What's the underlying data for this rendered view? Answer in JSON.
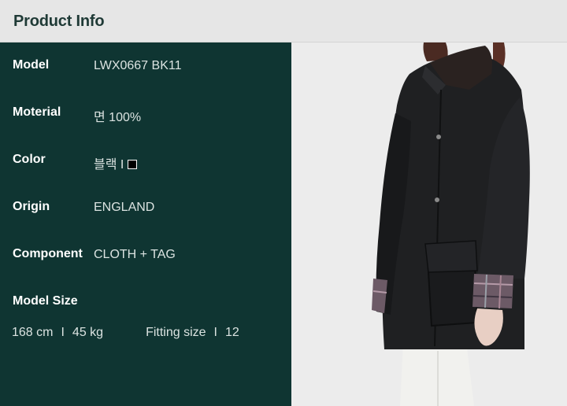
{
  "header": {
    "title": "Product Info"
  },
  "specs": [
    {
      "label": "Model",
      "value": "LWX0667 BK11"
    },
    {
      "label": "Moterial",
      "value": "면 100%"
    },
    {
      "label": "Color",
      "value": "블랙 I"
    },
    {
      "label": "Origin",
      "value": "ENGLAND"
    },
    {
      "label": "Component",
      "value": "CLOTH + TAG"
    }
  ],
  "color_swatch": "#000000",
  "model_size": {
    "label": "Model Size",
    "height": "168 cm",
    "divider": "I",
    "weight": "45 kg",
    "fitting_label": "Fitting size",
    "fitting_value": "12"
  },
  "colors": {
    "header_bg": "#e6e6e6",
    "panel_bg": "#0f3532",
    "photo_bg": "#ececec",
    "jacket": "#1e1f21",
    "collar": "#2a2220"
  }
}
